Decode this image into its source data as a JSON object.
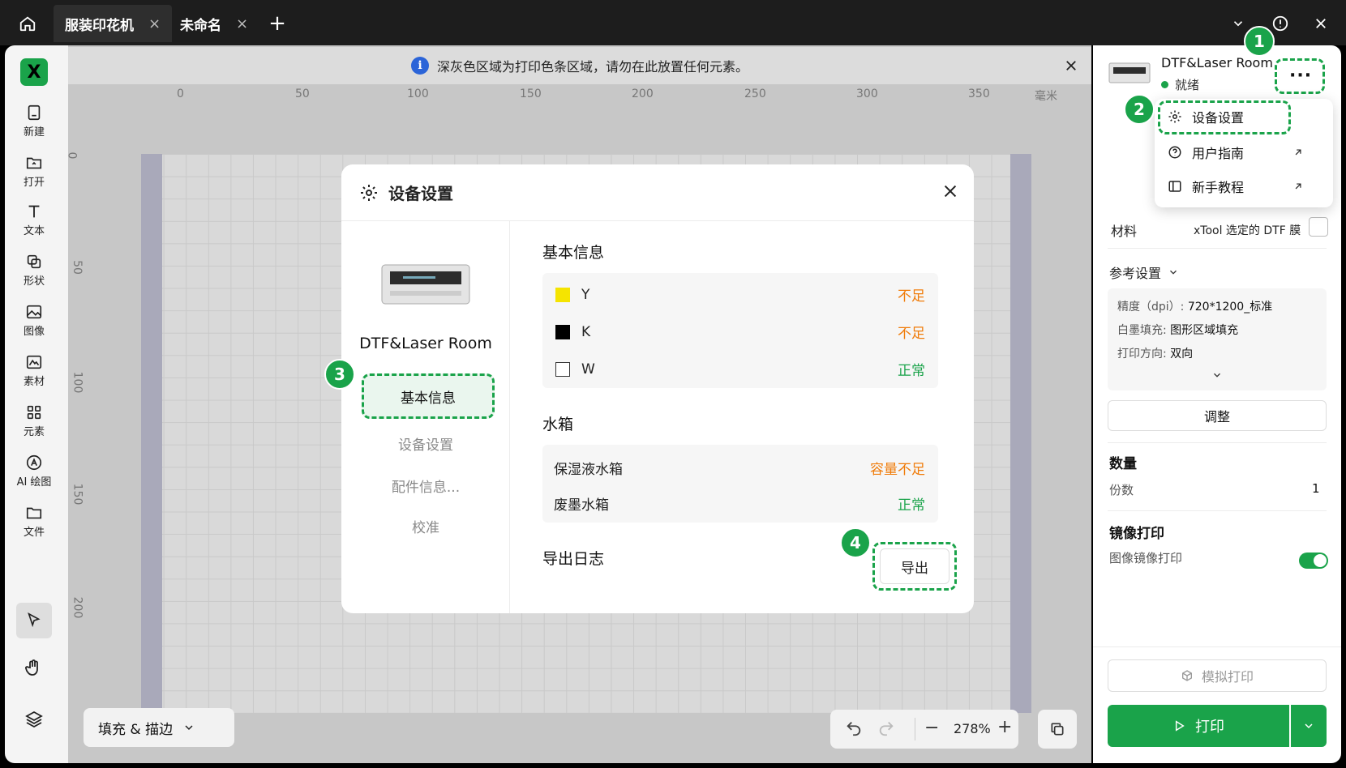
{
  "titlebar": {
    "tabs": [
      {
        "label": "服装印花机",
        "close": "×"
      },
      {
        "label": "未命名",
        "close": "×"
      }
    ],
    "add_tab": "+"
  },
  "leftbar": {
    "logo": "X",
    "items": [
      {
        "label": "新建",
        "icon": "new-file-icon"
      },
      {
        "label": "打开",
        "icon": "open-folder-icon"
      },
      {
        "label": "文本",
        "icon": "text-icon"
      },
      {
        "label": "形状",
        "icon": "shape-icon"
      },
      {
        "label": "图像",
        "icon": "image-icon"
      },
      {
        "label": "素材",
        "icon": "material-icon"
      },
      {
        "label": "元素",
        "icon": "elements-icon"
      },
      {
        "label": "AI 绘图",
        "icon": "ai-draw-icon"
      },
      {
        "label": "文件",
        "icon": "file-folder-icon"
      }
    ]
  },
  "canvas": {
    "notice": "深灰色区域为打印色条区域，请勿在此放置任何元素。",
    "ruler_x": [
      "0",
      "50",
      "100",
      "150",
      "200",
      "250",
      "300",
      "350"
    ],
    "ruler_unit": "毫米",
    "ruler_y": [
      "0",
      "50",
      "100",
      "150",
      "200"
    ],
    "fill_stroke_label": "填充 & 描边",
    "zoom": "278%",
    "zoom_minus": "−",
    "zoom_plus": "+"
  },
  "dialog": {
    "title": "设备设置",
    "device_name": "DTF&Laser Room",
    "nav": [
      "基本信息",
      "设备设置",
      "配件信息...",
      "校准"
    ],
    "basic_info_title": "基本信息",
    "inks": [
      {
        "name": "Y",
        "status": "不足",
        "color": "#f5e400",
        "state": "warn"
      },
      {
        "name": "K",
        "status": "不足",
        "color": "#000000",
        "state": "warn"
      },
      {
        "name": "W",
        "status": "正常",
        "color": "#ffffff",
        "state": "ok"
      }
    ],
    "tank_title": "水箱",
    "tanks": [
      {
        "name": "保湿液水箱",
        "status": "容量不足",
        "state": "warn"
      },
      {
        "name": "废墨水箱",
        "status": "正常",
        "state": "ok"
      }
    ],
    "export_log_title": "导出日志",
    "export_button": "导出"
  },
  "right_panel": {
    "device_name": "DTF&Laser Room",
    "device_status": "就绪",
    "menu": [
      {
        "label": "设备设置",
        "icon": "gear-icon"
      },
      {
        "label": "用户指南",
        "icon": "help-icon"
      },
      {
        "label": "新手教程",
        "icon": "book-icon"
      }
    ],
    "material_label": "材料",
    "material_value": "xTool 选定的 DTF 膜",
    "ref_settings": "参考设置",
    "precision_label": "精度（dpi）:",
    "precision_value": "720*1200_标准",
    "white_fill_label": "白墨填充:",
    "white_fill_value": "图形区域填充",
    "direction_label": "打印方向:",
    "direction_value": "双向",
    "adjust_button": "调整",
    "quantity_title": "数量",
    "copies_label": "份数",
    "copies_value": "1",
    "mirror_title": "镜像打印",
    "mirror_label": "图像镜像打印",
    "mirror_on": true,
    "simulate_button": "模拟打印",
    "print_button": "打印"
  },
  "badges": [
    "1",
    "2",
    "3",
    "4"
  ],
  "colors": {
    "accent": "#1aa34a",
    "warn": "#f07c0a",
    "info": "#2b64d8"
  }
}
